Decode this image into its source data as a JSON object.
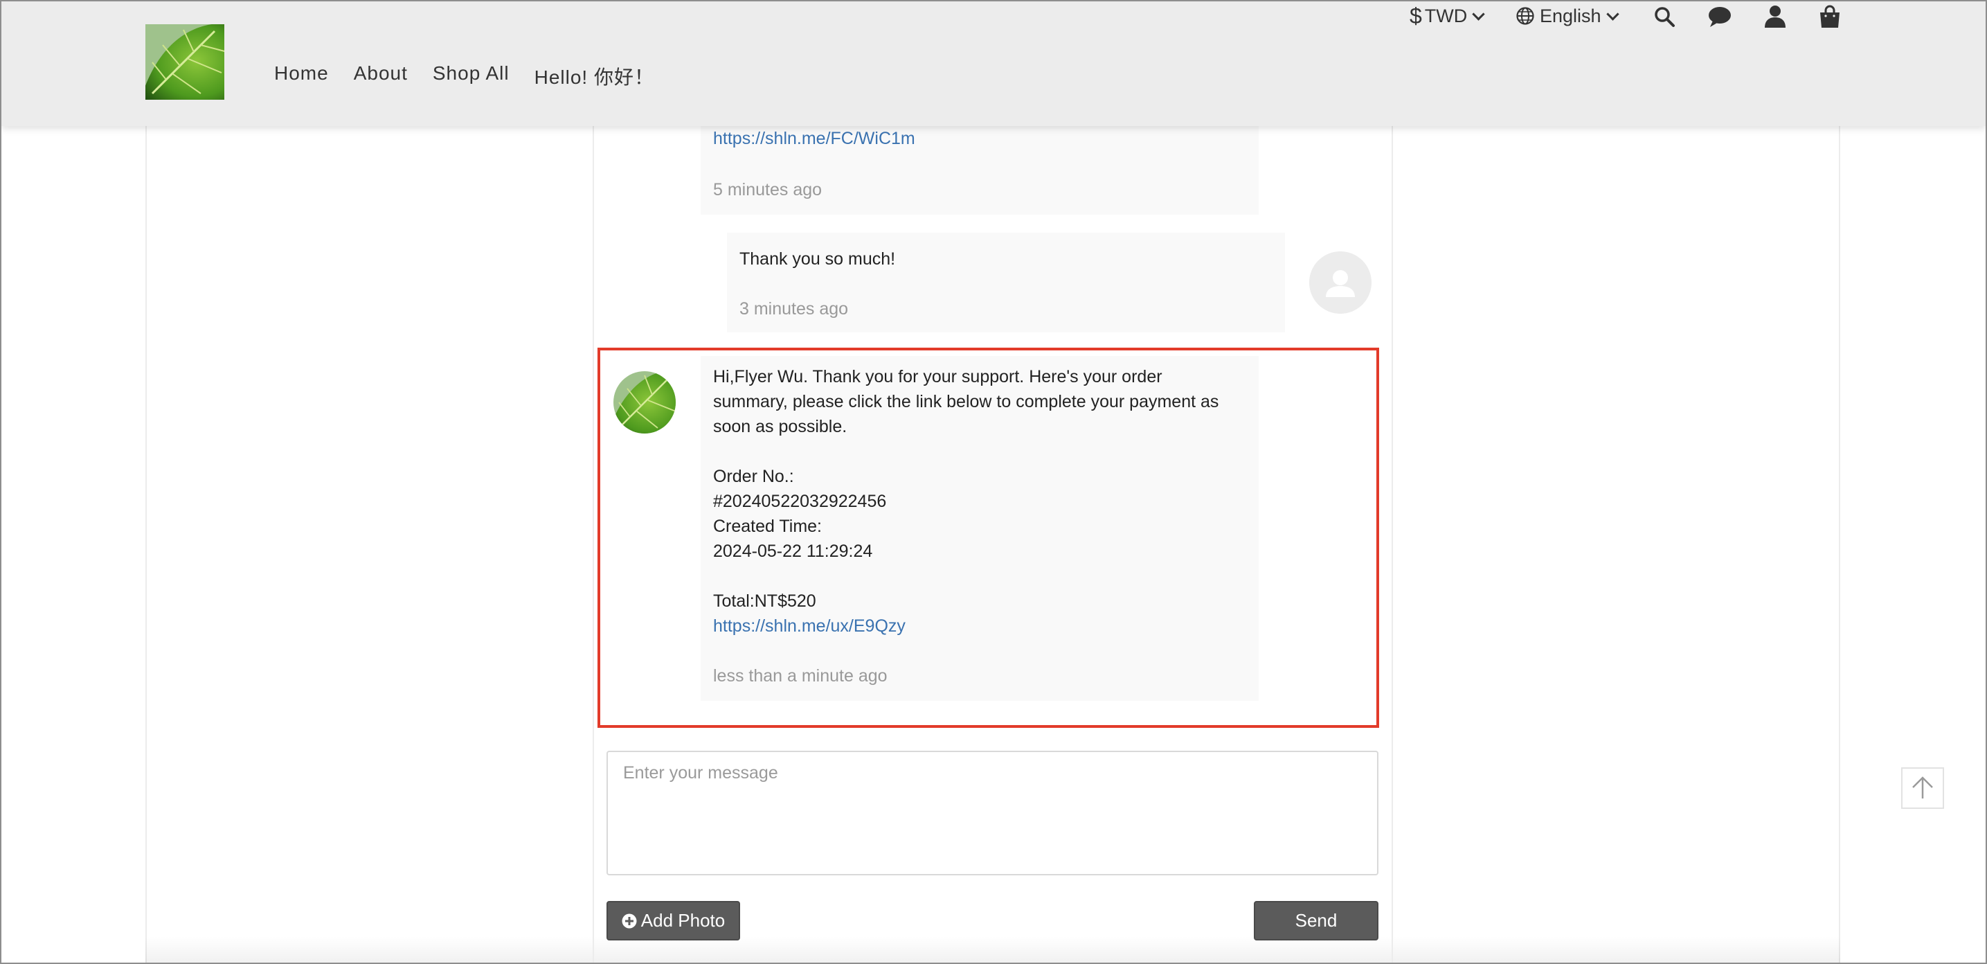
{
  "header": {
    "nav": [
      "Home",
      "About",
      "Shop All",
      "Hello! 你好！"
    ],
    "currency_symbol": "$",
    "currency": "TWD",
    "language": "English",
    "icons": [
      "search-icon",
      "chat-icon",
      "user-icon",
      "shopping-bag-icon"
    ]
  },
  "chat": {
    "msg1": {
      "link": "https://shln.me/FC/WiC1m",
      "time": "5 minutes ago"
    },
    "msg2": {
      "text": "Thank you so much!",
      "time": "3 minutes ago"
    },
    "msg3": {
      "line1": "Hi,Flyer Wu. Thank you for your support. Here's your order",
      "line2": "summary, please click the link below to complete your payment as",
      "line3": "soon as possible.",
      "order_label": "Order No.:",
      "order_no": "#20240522032922456",
      "created_label": "Created Time:",
      "created_time": "2024-05-22 11:29:24",
      "total": "Total:NT$520",
      "link": "https://shln.me/ux/E9Qzy",
      "time": "less than a minute ago"
    }
  },
  "composer": {
    "placeholder": "Enter your message",
    "add_photo": "Add Photo",
    "send": "Send"
  },
  "colors": {
    "header_bg": "#ececec",
    "highlight": "#e23b2a",
    "link": "#3a72b0",
    "button_bg": "#5b5b5b"
  }
}
